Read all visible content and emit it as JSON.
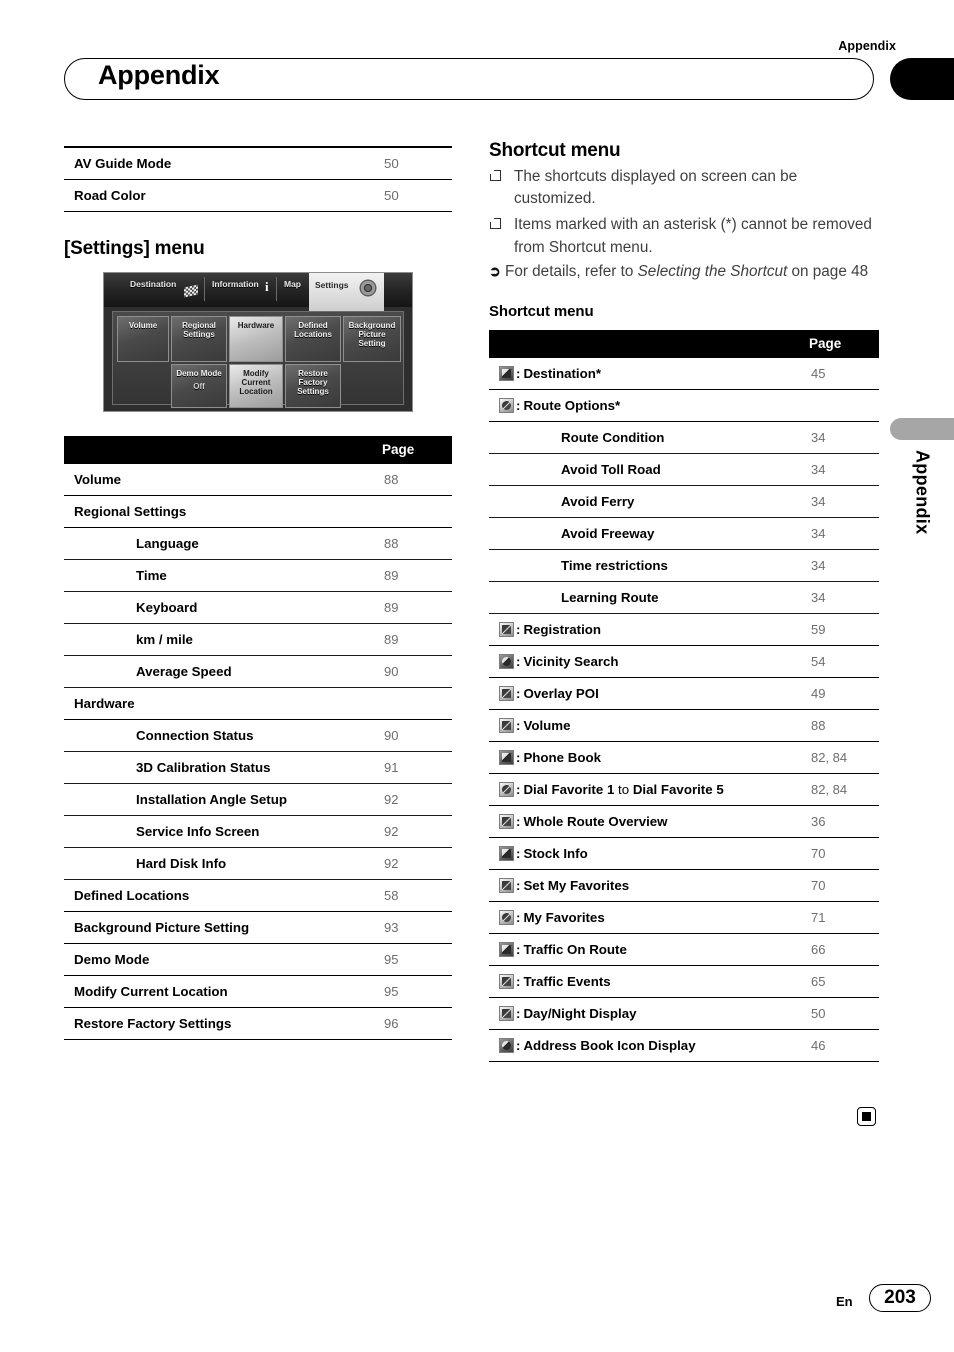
{
  "header": {
    "running_head": "Appendix",
    "chapter_title": "Appendix"
  },
  "side_tab": {
    "label": "Appendix"
  },
  "footer": {
    "language": "En",
    "page_number": "203"
  },
  "left_column": {
    "top_table": {
      "rows": [
        {
          "label": "AV Guide Mode",
          "page": "50"
        },
        {
          "label": "Road Color",
          "page": "50"
        }
      ]
    },
    "section_heading": "[Settings] menu",
    "screenshot": {
      "menu_tabs": [
        "Destination",
        "Information",
        "Map",
        "Settings"
      ],
      "selected_tab": "Settings",
      "buttons_row1": [
        "Volume",
        "Regional Settings",
        "Hardware",
        "Defined Locations",
        "Background Picture Setting"
      ],
      "buttons_row2": [
        "Demo Mode",
        "Modify Current Location",
        "Restore Factory Settings"
      ],
      "demo_mode_state": "Off",
      "modify_highlight": "Location"
    },
    "table": {
      "page_header": "Page",
      "rows": [
        {
          "label": "Volume",
          "page": "88",
          "indent": 1
        },
        {
          "label": "Regional Settings",
          "page": "",
          "indent": 1
        },
        {
          "label": "Language",
          "page": "88",
          "indent": 2
        },
        {
          "label": "Time",
          "page": "89",
          "indent": 2
        },
        {
          "label": "Keyboard",
          "page": "89",
          "indent": 2
        },
        {
          "label": "km / mile",
          "page": "89",
          "indent": 2
        },
        {
          "label": "Average Speed",
          "page": "90",
          "indent": 2
        },
        {
          "label": "Hardware",
          "page": "",
          "indent": 1
        },
        {
          "label": "Connection Status",
          "page": "90",
          "indent": 2
        },
        {
          "label": "3D Calibration Status",
          "page": "91",
          "indent": 2
        },
        {
          "label": "Installation Angle Setup",
          "page": "92",
          "indent": 2
        },
        {
          "label": "Service Info Screen",
          "page": "92",
          "indent": 2
        },
        {
          "label": "Hard Disk Info",
          "page": "92",
          "indent": 2
        },
        {
          "label": "Defined Locations",
          "page": "58",
          "indent": 1
        },
        {
          "label": "Background Picture Setting",
          "page": "93",
          "indent": 1
        },
        {
          "label": "Demo Mode",
          "page": "95",
          "indent": 1
        },
        {
          "label": "Modify Current Location",
          "page": "95",
          "indent": 1
        },
        {
          "label": "Restore Factory Settings",
          "page": "96",
          "indent": 1
        }
      ]
    }
  },
  "right_column": {
    "section_heading": "Shortcut menu",
    "notes": [
      "The shortcuts displayed on screen can be customized.",
      "Items marked with an asterisk (*) cannot be removed from Shortcut menu."
    ],
    "reference": {
      "prefix": "For details, refer to ",
      "italic": "Selecting the Shortcut",
      "suffix": " on page 48"
    },
    "table_heading": "Shortcut menu",
    "table": {
      "page_header": "Page",
      "rows": [
        {
          "icon": "destination-icon",
          "label": "Destination*",
          "page": "45",
          "indent": 1
        },
        {
          "icon": "route-options-icon",
          "label": "Route Options*",
          "page": "",
          "indent": 1
        },
        {
          "icon": "",
          "label": "Route Condition",
          "page": "34",
          "indent": 2
        },
        {
          "icon": "",
          "label": "Avoid Toll Road",
          "page": "34",
          "indent": 2
        },
        {
          "icon": "",
          "label": "Avoid Ferry",
          "page": "34",
          "indent": 2
        },
        {
          "icon": "",
          "label": "Avoid Freeway",
          "page": "34",
          "indent": 2
        },
        {
          "icon": "",
          "label": "Time restrictions",
          "page": "34",
          "indent": 2
        },
        {
          "icon": "",
          "label": "Learning Route",
          "page": "34",
          "indent": 2
        },
        {
          "icon": "registration-icon",
          "label": "Registration",
          "page": "59",
          "indent": 1
        },
        {
          "icon": "vicinity-search-icon",
          "label": "Vicinity Search",
          "page": "54",
          "indent": 1
        },
        {
          "icon": "overlay-poi-icon",
          "label": "Overlay POI",
          "page": "49",
          "indent": 1
        },
        {
          "icon": "volume-icon",
          "label": "Volume",
          "page": "88",
          "indent": 1
        },
        {
          "icon": "phone-book-icon",
          "label": "Phone Book",
          "page": "82, 84",
          "indent": 1
        },
        {
          "icon": "dial-favorite-icon",
          "label": "Dial Favorite 1 to Dial Favorite 5",
          "page": "82, 84",
          "indent": 1
        },
        {
          "icon": "whole-route-overview-icon",
          "label": "Whole Route Overview",
          "page": "36",
          "indent": 1
        },
        {
          "icon": "stock-info-icon",
          "label": "Stock Info",
          "page": "70",
          "indent": 1
        },
        {
          "icon": "set-my-favorites-icon",
          "label": "Set My Favorites",
          "page": "70",
          "indent": 1
        },
        {
          "icon": "my-favorites-icon",
          "label": "My Favorites",
          "page": "71",
          "indent": 1
        },
        {
          "icon": "traffic-on-route-icon",
          "label": "Traffic On Route",
          "page": "66",
          "indent": 1
        },
        {
          "icon": "traffic-events-icon",
          "label": "Traffic Events",
          "page": "65",
          "indent": 1
        },
        {
          "icon": "day-night-display-icon",
          "label": "Day/Night Display",
          "page": "50",
          "indent": 1
        },
        {
          "icon": "address-book-icon-display-icon",
          "label": "Address Book Icon Display",
          "page": "46",
          "indent": 1
        }
      ]
    }
  }
}
